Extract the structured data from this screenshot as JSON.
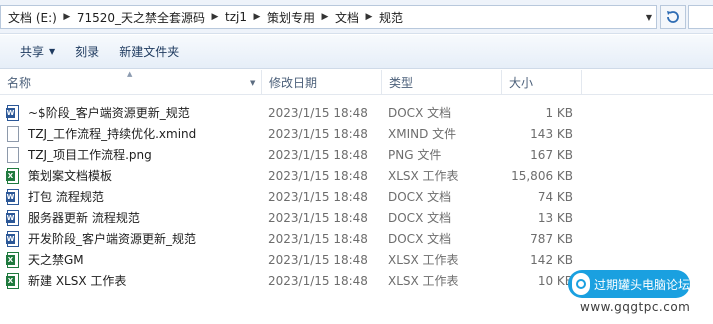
{
  "address_bar": {
    "crumbs": [
      "文档 (E:)",
      "71520_天之禁全套源码",
      "tzj1",
      "策划专用",
      "文档",
      "规范"
    ]
  },
  "toolbar": {
    "share_label": "共享",
    "burn_label": "刻录",
    "new_folder_label": "新建文件夹"
  },
  "columns": {
    "name": "名称",
    "modified": "修改日期",
    "type": "类型",
    "size": "大小"
  },
  "files": [
    {
      "name": "~$阶段_客户端资源更新_规范",
      "modified": "2023/1/15 18:48",
      "type": "DOCX 文档",
      "size": "1 KB",
      "icon": "docx-file-icon"
    },
    {
      "name": "TZJ_工作流程_持续优化.xmind",
      "modified": "2023/1/15 18:48",
      "type": "XMIND 文件",
      "size": "143 KB",
      "icon": "generic-file-icon"
    },
    {
      "name": "TZJ_项目工作流程.png",
      "modified": "2023/1/15 18:48",
      "type": "PNG 文件",
      "size": "167 KB",
      "icon": "generic-file-icon"
    },
    {
      "name": "策划案文档模板",
      "modified": "2023/1/15 18:48",
      "type": "XLSX 工作表",
      "size": "15,806 KB",
      "icon": "xlsx-file-icon"
    },
    {
      "name": "打包 流程规范",
      "modified": "2023/1/15 18:48",
      "type": "DOCX 文档",
      "size": "74 KB",
      "icon": "docx-file-icon"
    },
    {
      "name": "服务器更新 流程规范",
      "modified": "2023/1/15 18:48",
      "type": "DOCX 文档",
      "size": "13 KB",
      "icon": "docx-file-icon"
    },
    {
      "name": "开发阶段_客户端资源更新_规范",
      "modified": "2023/1/15 18:48",
      "type": "DOCX 文档",
      "size": "787 KB",
      "icon": "docx-file-icon"
    },
    {
      "name": "天之禁GM",
      "modified": "2023/1/15 18:48",
      "type": "XLSX 工作表",
      "size": "142 KB",
      "icon": "xlsx-file-icon"
    },
    {
      "name": "新建 XLSX 工作表",
      "modified": "2023/1/15 18:48",
      "type": "XLSX 工作表",
      "size": "10 KB",
      "icon": "xlsx-file-icon"
    }
  ],
  "watermark": {
    "text": "过期罐头电脑论坛",
    "url": "www.gqgtpc.com"
  }
}
